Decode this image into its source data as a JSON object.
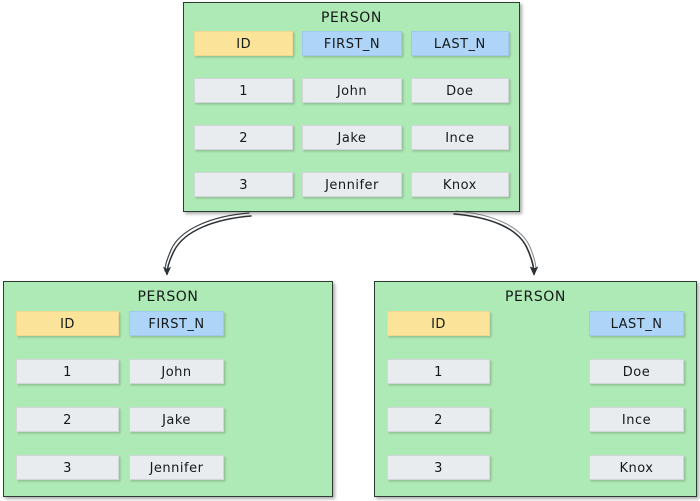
{
  "diagram": {
    "type": "database-vertical-partition",
    "colors": {
      "table_background": "#aeeab5",
      "table_border": "#2d3b30",
      "cell_background": "#e9ecef",
      "primary_key_background": "#fbe49a",
      "attribute_background": "#aed4f7",
      "arrow": "#2b3034",
      "page_background": "#ffffff"
    }
  },
  "tables": {
    "source": {
      "title": "PERSON",
      "columns": [
        {
          "label": "ID",
          "kind": "primary-key"
        },
        {
          "label": "FIRST_N",
          "kind": "attribute"
        },
        {
          "label": "LAST_N",
          "kind": "attribute"
        }
      ],
      "rows": [
        [
          "1",
          "John",
          "Doe"
        ],
        [
          "2",
          "Jake",
          "Ince"
        ],
        [
          "3",
          "Jennifer",
          "Knox"
        ]
      ]
    },
    "left": {
      "title": "PERSON",
      "columns": [
        {
          "label": "ID",
          "kind": "primary-key"
        },
        {
          "label": "FIRST_N",
          "kind": "attribute"
        }
      ],
      "rows": [
        [
          "1",
          "John"
        ],
        [
          "2",
          "Jake"
        ],
        [
          "3",
          "Jennifer"
        ]
      ]
    },
    "right": {
      "title": "PERSON",
      "columns": [
        {
          "label": "ID",
          "kind": "primary-key"
        },
        {
          "label": "LAST_N",
          "kind": "attribute"
        }
      ],
      "rows": [
        [
          "1",
          "Doe"
        ],
        [
          "2",
          "Ince"
        ],
        [
          "3",
          "Knox"
        ]
      ]
    }
  },
  "arrows": [
    {
      "name": "arrow-to-left-table",
      "from": "source",
      "to": "left"
    },
    {
      "name": "arrow-to-right-table",
      "from": "source",
      "to": "right"
    }
  ]
}
